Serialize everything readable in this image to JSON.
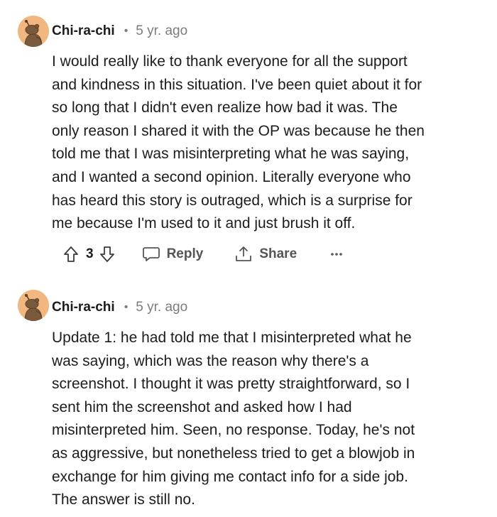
{
  "colors": {
    "text": "#1c1c1c",
    "meta": "#7c7c7c",
    "action": "#555555",
    "avatar_bg": "#f2b77f",
    "avatar_figure": "#7a5a3c"
  },
  "comments": [
    {
      "username": "Chi-ra-chi",
      "separator": "•",
      "time": "5 yr. ago",
      "avatar_icon": "snoo-avatar-icon",
      "body": "I would really like to thank everyone for all the support\nand kindness in this situation. I've been quiet about it for\nso long that I didn't even realize how bad it was. The\nonly reason I shared it with the OP was because he then\ntold me that I was misinterpreting what he was saying,\nand I wanted a second opinion. Literally everyone who\nhas heard this story is outraged, which is a surprise for\nme because I'm used to it and just brush it off.",
      "score": "3",
      "reply_label": "Reply",
      "share_label": "Share",
      "icons": {
        "upvote": "upvote-arrow-icon",
        "downvote": "downvote-arrow-icon",
        "reply": "speech-bubble-icon",
        "share": "share-upload-icon",
        "more": "more-dots-icon"
      }
    },
    {
      "username": "Chi-ra-chi",
      "separator": "•",
      "time": "5 yr. ago",
      "avatar_icon": "snoo-avatar-icon",
      "body": "Update 1: he had told me that I misinterpreted what he\nwas saying, which was the reason why there's a\nscreenshot. I thought it was pretty straightforward, so I\nsent him the screenshot and asked how I had\nmisinterpreted him. Seen, no response. Today, he's not\nas aggressive, but nonetheless tried to get a blowjob in\nexchange for him giving me contact info for a side job.\nThe answer is still no."
    }
  ]
}
